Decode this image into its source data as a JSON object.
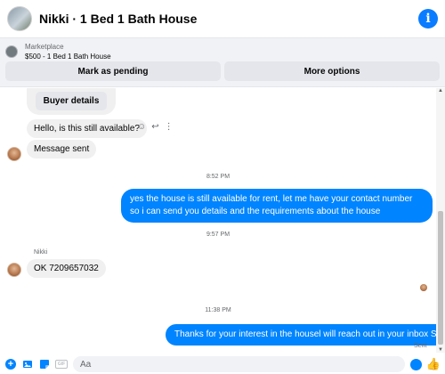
{
  "header": {
    "title": "Nikki · 1 Bed 1 Bath House",
    "info_icon": "info-icon"
  },
  "marketplace": {
    "label": "Marketplace",
    "item": "$500 - 1 Bed 1 Bath House",
    "buttons": {
      "mark_pending": "Mark as pending",
      "more_options": "More options"
    }
  },
  "chat": {
    "buyer_details_label": "Buyer details",
    "messages": [
      {
        "text": "Hello, is this still available?",
        "sender": "them"
      },
      {
        "text": "Message sent",
        "sender": "them"
      },
      {
        "time": "8:52 PM"
      },
      {
        "text": "yes the house is still available for rent, let me have your contact number so i can send you details and the requirements about the house",
        "sender": "me"
      },
      {
        "time": "9:57 PM"
      },
      {
        "name": "Nikki",
        "text": "OK 7209657032",
        "sender": "them"
      },
      {
        "time": "11:38 PM"
      },
      {
        "text": "Thanks for your interest in the housel will reach out in your inbox Shortly",
        "sender": "me"
      }
    ],
    "status": "Sent"
  },
  "composer": {
    "placeholder": "Aa"
  },
  "colors": {
    "accent": "#0084ff",
    "bubble_in": "#f0f0f0",
    "bar_bg": "#f0f2f5"
  }
}
